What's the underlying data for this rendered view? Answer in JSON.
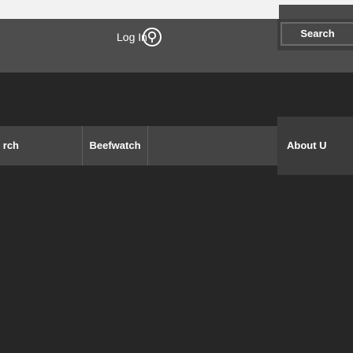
{
  "header": {
    "login_label": "Log In",
    "help_icon": "help-circle-icon",
    "search_button_label": "Search"
  },
  "nav": {
    "items": [
      {
        "label": "rch"
      },
      {
        "label": "Beefwatch"
      },
      {
        "label": "About U"
      }
    ]
  },
  "colors": {
    "page_background": "#262626",
    "header_background": "#4d4d4d",
    "nav_background": "#444444",
    "top_strip": "#f2f2f2",
    "text": "#ffffff"
  }
}
